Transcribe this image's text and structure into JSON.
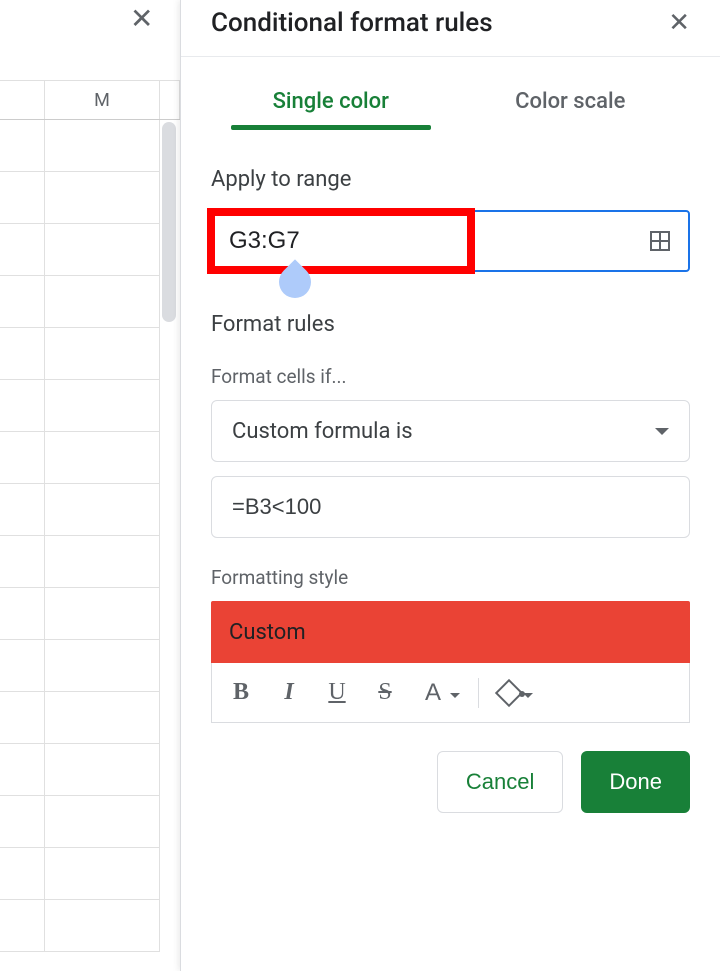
{
  "panel": {
    "title": "Conditional format rules",
    "tabs": {
      "single": "Single color",
      "scale": "Color scale"
    },
    "apply_range_label": "Apply to range",
    "range_value": "G3:G7",
    "format_rules_label": "Format rules",
    "format_cells_if_label": "Format cells if...",
    "condition_selected": "Custom formula is",
    "formula_value": "=B3<100",
    "formatting_style_label": "Formatting style",
    "style_preview_text": "Custom",
    "style_preview_bg": "#ea4335",
    "toolbar": {
      "bold": "B",
      "italic": "I",
      "underline": "U",
      "strike": "S",
      "textcolor": "A"
    },
    "cancel_label": "Cancel",
    "done_label": "Done"
  },
  "sheet": {
    "col_m": "M"
  }
}
